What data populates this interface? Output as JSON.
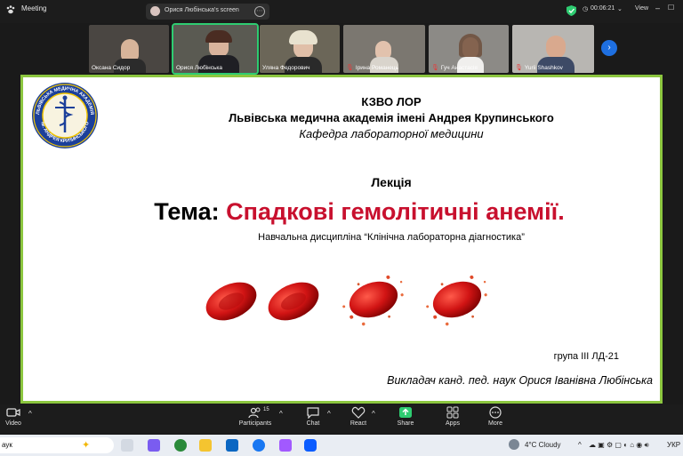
{
  "topbar": {
    "app_label": "Meeting",
    "share_label": "Орися Любінська's screen",
    "timer": "00:06:21",
    "view_label": "View",
    "colors": {
      "shield": "#2ecc71"
    }
  },
  "participants": [
    {
      "name": "Оксана Сидор",
      "muted": false
    },
    {
      "name": "Орися Любінська",
      "muted": false,
      "active": true
    },
    {
      "name": "Уляна Федорович",
      "muted": false
    },
    {
      "name": "Ірина Романець",
      "muted": true
    },
    {
      "name": "Гуч Анастасія",
      "muted": true
    },
    {
      "name": "Yurii Shashkov",
      "muted": true
    }
  ],
  "slide": {
    "org_abbr": "КЗВО ЛОР",
    "academy": "Львівська медична академія імені Андрея Крупинського",
    "department": "Кафедра лабораторної медицини",
    "lecture_label": "Лекція",
    "topic_prefix": "Тема: ",
    "topic": "Спадкові гемолітичні анемії.",
    "discipline": "Навчальна дисципліна “Клінічна лабораторна діагностика”",
    "group": "група ІІІ ЛД-21",
    "lecturer": "Викладач канд. пед. наук Орися Іванівна Любінська",
    "seal_text_top": "ЛЬВІВСЬКА МЕДИЧНА АКАДЕМІЯ",
    "seal_text_bottom": "ім. АНДРЕЯ КРУПИНСЬКОГО",
    "colors": {
      "topic": "#c8102e",
      "border": "#8cc63f",
      "seal": "#1b3f9a",
      "seal_ring": "#f2c500"
    }
  },
  "toolbar": {
    "video": "Video",
    "participants": "Participants",
    "participant_count": "15",
    "chat": "Chat",
    "react": "React",
    "share": "Share",
    "apps": "Apps",
    "more": "More",
    "colors": {
      "share": "#2ecc71"
    }
  },
  "taskbar": {
    "search_text": "аук",
    "weather": "4°C  Cloudy",
    "lang": "УКР"
  }
}
